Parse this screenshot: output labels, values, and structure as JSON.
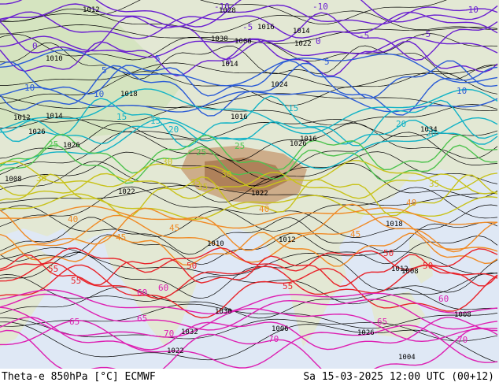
{
  "footer": {
    "product": "Theta-e 850hPa [°C] ECMWF",
    "valid_time": "Sa 15-03-2025 12:00 UTC (00+12)"
  },
  "colors": {
    "sea": "#dfe8f5",
    "land_north": "#e3e8d4",
    "land_green": "#cfe3b8",
    "land_brown": "#c9a27c",
    "land_dark_brown": "#a8754d",
    "isobar": "#000000",
    "theta_cold": "#6a1fd0",
    "theta_cool": "#2a5bd6",
    "theta_mild": "#12b3c6",
    "theta_warm": "#4fc34f",
    "theta_yellow": "#c8c21a",
    "theta_orange": "#f08a24",
    "theta_red": "#e8232a",
    "theta_magenta": "#dd1fb2"
  },
  "isobar_labels": [
    "1026",
    "1012",
    "1022",
    "1026",
    "1010",
    "1032",
    "1026",
    "1030",
    "1038",
    "1034",
    "1018",
    "1026",
    "1022",
    "1018",
    "1016",
    "1014",
    "1016",
    "1022",
    "1024",
    "1012",
    "1006",
    "1008",
    "1028",
    "1022",
    "1014",
    "1010",
    "1008",
    "1012",
    "1004",
    "1008",
    "1006",
    "1012",
    "1014",
    "1016"
  ],
  "theta_labels": [
    {
      "text": "-10",
      "tone": "theta_cold"
    },
    {
      "text": "-5",
      "tone": "theta_cold"
    },
    {
      "text": "0",
      "tone": "theta_cold"
    },
    {
      "text": "5",
      "tone": "theta_cool"
    },
    {
      "text": "10",
      "tone": "theta_cool"
    },
    {
      "text": "15",
      "tone": "theta_mild"
    },
    {
      "text": "20",
      "tone": "theta_mild"
    },
    {
      "text": "25",
      "tone": "theta_warm"
    },
    {
      "text": "30",
      "tone": "theta_yellow"
    },
    {
      "text": "35",
      "tone": "theta_yellow"
    },
    {
      "text": "40",
      "tone": "theta_orange"
    },
    {
      "text": "45",
      "tone": "theta_orange"
    },
    {
      "text": "50",
      "tone": "theta_red"
    },
    {
      "text": "55",
      "tone": "theta_red"
    },
    {
      "text": "60",
      "tone": "theta_magenta"
    },
    {
      "text": "65",
      "tone": "theta_magenta"
    },
    {
      "text": "70",
      "tone": "theta_magenta"
    }
  ]
}
